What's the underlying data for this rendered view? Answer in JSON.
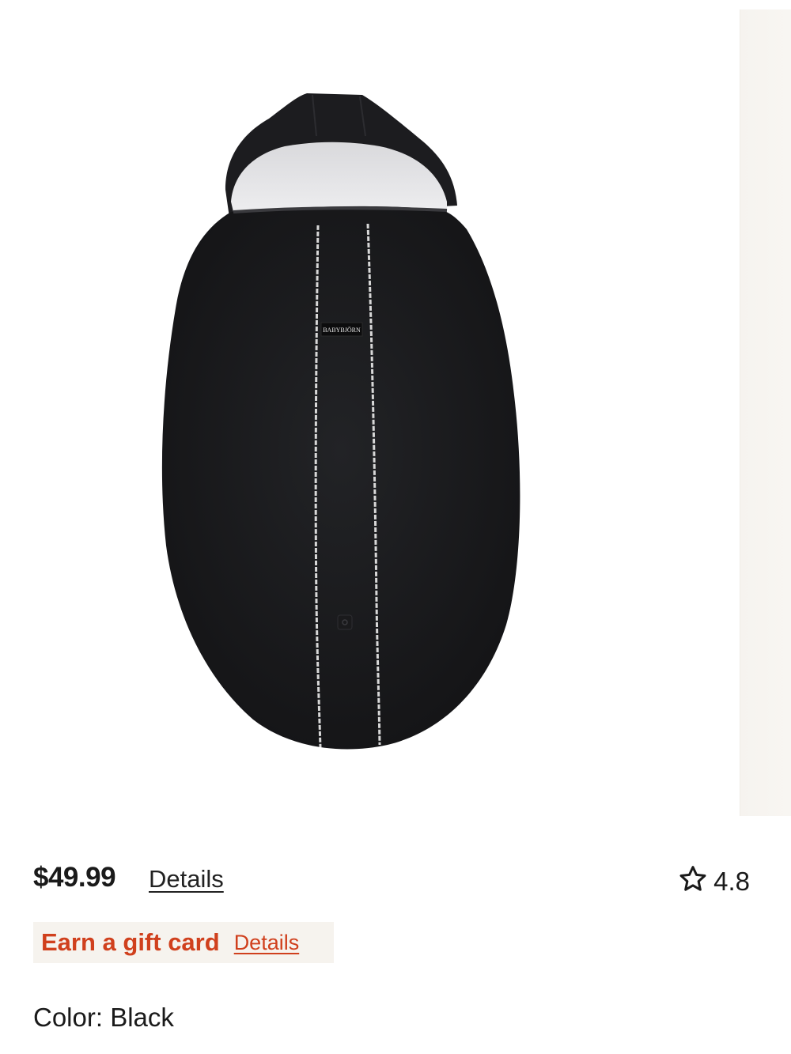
{
  "product": {
    "image_alt": "Black fleece baby carrier cover with hood",
    "brand_tag": "BABYBJÖRN",
    "price": "$49.99",
    "price_details_label": "Details",
    "rating": "4.8",
    "rating_icon": "star-outline-icon",
    "gift_card": {
      "label": "Earn a gift card",
      "details_label": "Details",
      "color": "#d0401d"
    },
    "color_label": "Color:",
    "color_value": "Black"
  }
}
